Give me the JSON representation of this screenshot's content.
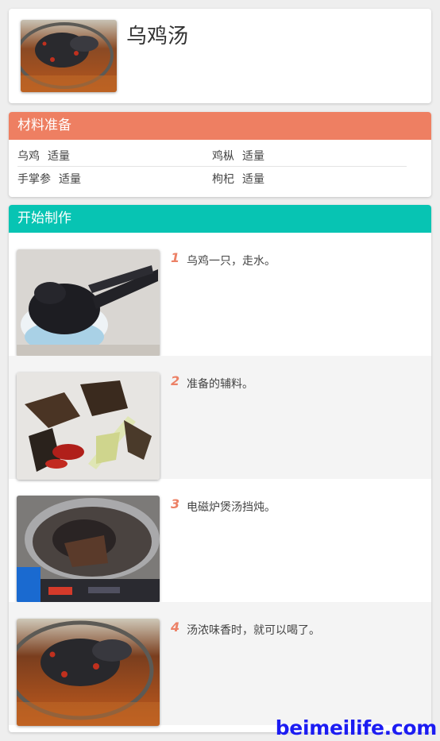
{
  "recipe": {
    "title": "乌鸡汤"
  },
  "ingredients": {
    "header": "材料准备",
    "items": [
      {
        "name": "乌鸡",
        "qty": "适量"
      },
      {
        "name": "鸡枞",
        "qty": "适量"
      },
      {
        "name": "手掌参",
        "qty": "适量"
      },
      {
        "name": "枸杞",
        "qty": "适量"
      }
    ]
  },
  "steps": {
    "header": "开始制作",
    "items": [
      {
        "num": "1",
        "text": "乌鸡一只，走水。"
      },
      {
        "num": "2",
        "text": "准备的辅料。"
      },
      {
        "num": "3",
        "text": "电磁炉煲汤挡炖。"
      },
      {
        "num": "4",
        "text": "汤浓味香时，就可以喝了。"
      }
    ]
  },
  "colors": {
    "ingredients_header": "#ee7f62",
    "steps_header": "#07c4b3",
    "step_number": "#ec8166",
    "watermark": "#1c1cf2"
  },
  "watermark": "beimeilife.com"
}
